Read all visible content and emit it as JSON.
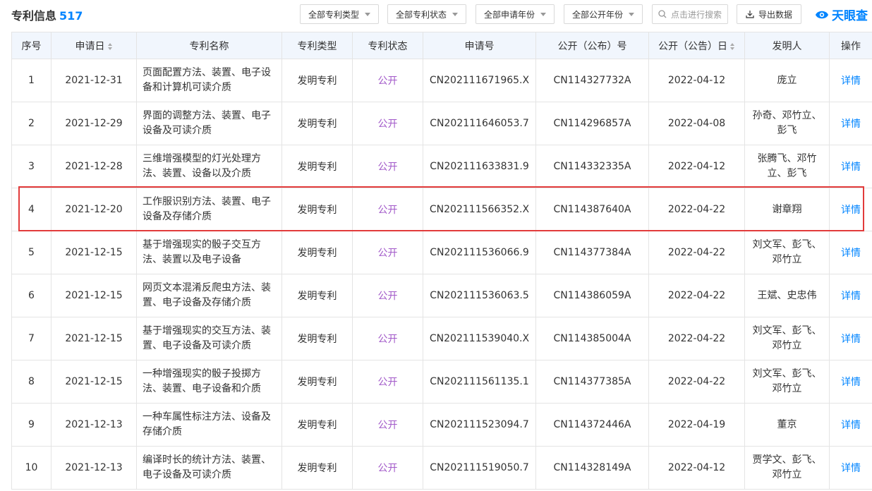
{
  "header": {
    "title": "专利信息",
    "count": "517",
    "filters": [
      "全部专利类型",
      "全部专利状态",
      "全部申请年份",
      "全部公开年份"
    ],
    "search_placeholder": "点击进行搜索",
    "export_label": "导出数据",
    "logo_text": "天眼查"
  },
  "table": {
    "columns": [
      "序号",
      "申请日",
      "专利名称",
      "专利类型",
      "专利状态",
      "申请号",
      "公开（公布）号",
      "公开（公告）日",
      "发明人",
      "操作"
    ],
    "rows": [
      {
        "no": "1",
        "date": "2021-12-31",
        "name_l1": "页面配置方法、装置、电子设",
        "name_l2": "备和计算机可读介质",
        "type": "发明专利",
        "status": "公开",
        "app_no": "CN202111671965.X",
        "pub_no": "CN114327732A",
        "pub_date": "2022-04-12",
        "inv_l1": "庞立",
        "inv_l2": "",
        "op": "详情"
      },
      {
        "no": "2",
        "date": "2021-12-29",
        "name_l1": "界面的调整方法、装置、电子",
        "name_l2": "设备及可读介质",
        "type": "发明专利",
        "status": "公开",
        "app_no": "CN202111646053.7",
        "pub_no": "CN114296857A",
        "pub_date": "2022-04-08",
        "inv_l1": "孙奇、邓竹立、",
        "inv_l2": "彭飞",
        "op": "详情"
      },
      {
        "no": "3",
        "date": "2021-12-28",
        "name_l1": "三维增强模型的灯光处理方",
        "name_l2": "法、装置、设备以及介质",
        "type": "发明专利",
        "status": "公开",
        "app_no": "CN202111633831.9",
        "pub_no": "CN114332335A",
        "pub_date": "2022-04-12",
        "inv_l1": "张腾飞、邓竹",
        "inv_l2": "立、彭飞",
        "op": "详情"
      },
      {
        "no": "4",
        "date": "2021-12-20",
        "name_l1": "工作服识别方法、装置、电子",
        "name_l2": "设备及存储介质",
        "type": "发明专利",
        "status": "公开",
        "app_no": "CN202111566352.X",
        "pub_no": "CN114387640A",
        "pub_date": "2022-04-22",
        "inv_l1": "谢章翔",
        "inv_l2": "",
        "op": "详情"
      },
      {
        "no": "5",
        "date": "2021-12-15",
        "name_l1": "基于增强现实的骰子交互方",
        "name_l2": "法、装置以及电子设备",
        "type": "发明专利",
        "status": "公开",
        "app_no": "CN202111536066.9",
        "pub_no": "CN114377384A",
        "pub_date": "2022-04-22",
        "inv_l1": "刘文军、彭飞、",
        "inv_l2": "邓竹立",
        "op": "详情"
      },
      {
        "no": "6",
        "date": "2021-12-15",
        "name_l1": "网页文本混淆反爬虫方法、装",
        "name_l2": "置、电子设备及存储介质",
        "type": "发明专利",
        "status": "公开",
        "app_no": "CN202111536063.5",
        "pub_no": "CN114386059A",
        "pub_date": "2022-04-22",
        "inv_l1": "王斌、史忠伟",
        "inv_l2": "",
        "op": "详情"
      },
      {
        "no": "7",
        "date": "2021-12-15",
        "name_l1": "基于增强现实的交互方法、装",
        "name_l2": "置、电子设备及可读介质",
        "type": "发明专利",
        "status": "公开",
        "app_no": "CN202111539040.X",
        "pub_no": "CN114385004A",
        "pub_date": "2022-04-22",
        "inv_l1": "刘文军、彭飞、",
        "inv_l2": "邓竹立",
        "op": "详情"
      },
      {
        "no": "8",
        "date": "2021-12-15",
        "name_l1": "一种增强现实的骰子投掷方",
        "name_l2": "法、装置、电子设备和介质",
        "type": "发明专利",
        "status": "公开",
        "app_no": "CN202111561135.1",
        "pub_no": "CN114377385A",
        "pub_date": "2022-04-22",
        "inv_l1": "刘文军、彭飞、",
        "inv_l2": "邓竹立",
        "op": "详情"
      },
      {
        "no": "9",
        "date": "2021-12-13",
        "name_l1": "一种车属性标注方法、设备及",
        "name_l2": "存储介质",
        "type": "发明专利",
        "status": "公开",
        "app_no": "CN202111523094.7",
        "pub_no": "CN114372446A",
        "pub_date": "2022-04-19",
        "inv_l1": "董京",
        "inv_l2": "",
        "op": "详情"
      },
      {
        "no": "10",
        "date": "2021-12-13",
        "name_l1": "编译时长的统计方法、装置、",
        "name_l2": "电子设备及可读介质",
        "type": "发明专利",
        "status": "公开",
        "app_no": "CN202111519050.7",
        "pub_no": "CN114328149A",
        "pub_date": "2022-04-12",
        "inv_l1": "贾学文、彭飞、",
        "inv_l2": "邓竹立",
        "op": "详情"
      }
    ]
  },
  "colors": {
    "accent": "#0084ff",
    "status_purple": "#a259c9",
    "highlight_red": "#e23b3b",
    "header_bg": "#f1f6fd"
  }
}
